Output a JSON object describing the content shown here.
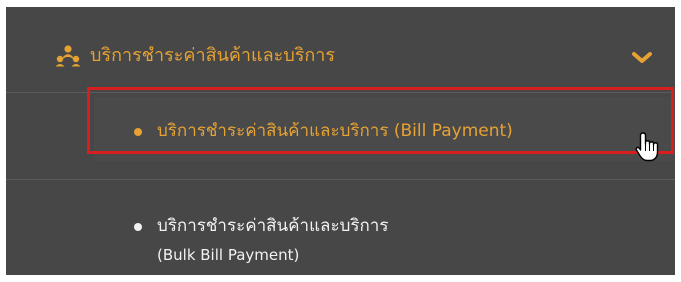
{
  "menu": {
    "header": {
      "label": "บริการชำระค่าสินค้าและบริการ",
      "icon": "network-icon",
      "expand_icon": "chevron-down-icon"
    },
    "items": [
      {
        "label": "บริการชำระค่าสินค้าและบริการ (Bill Payment)",
        "active": true
      },
      {
        "label": "บริการชำระค่าสินค้าและบริการ",
        "label_line2": "(Bulk Bill Payment)",
        "active": false
      }
    ]
  },
  "annotation": {
    "highlight_color": "#d81e1e",
    "cursor_icon": "hand-pointer-icon"
  },
  "colors": {
    "panel_bg": "#474747",
    "accent": "#e6a233",
    "text": "#f2f2f2"
  }
}
